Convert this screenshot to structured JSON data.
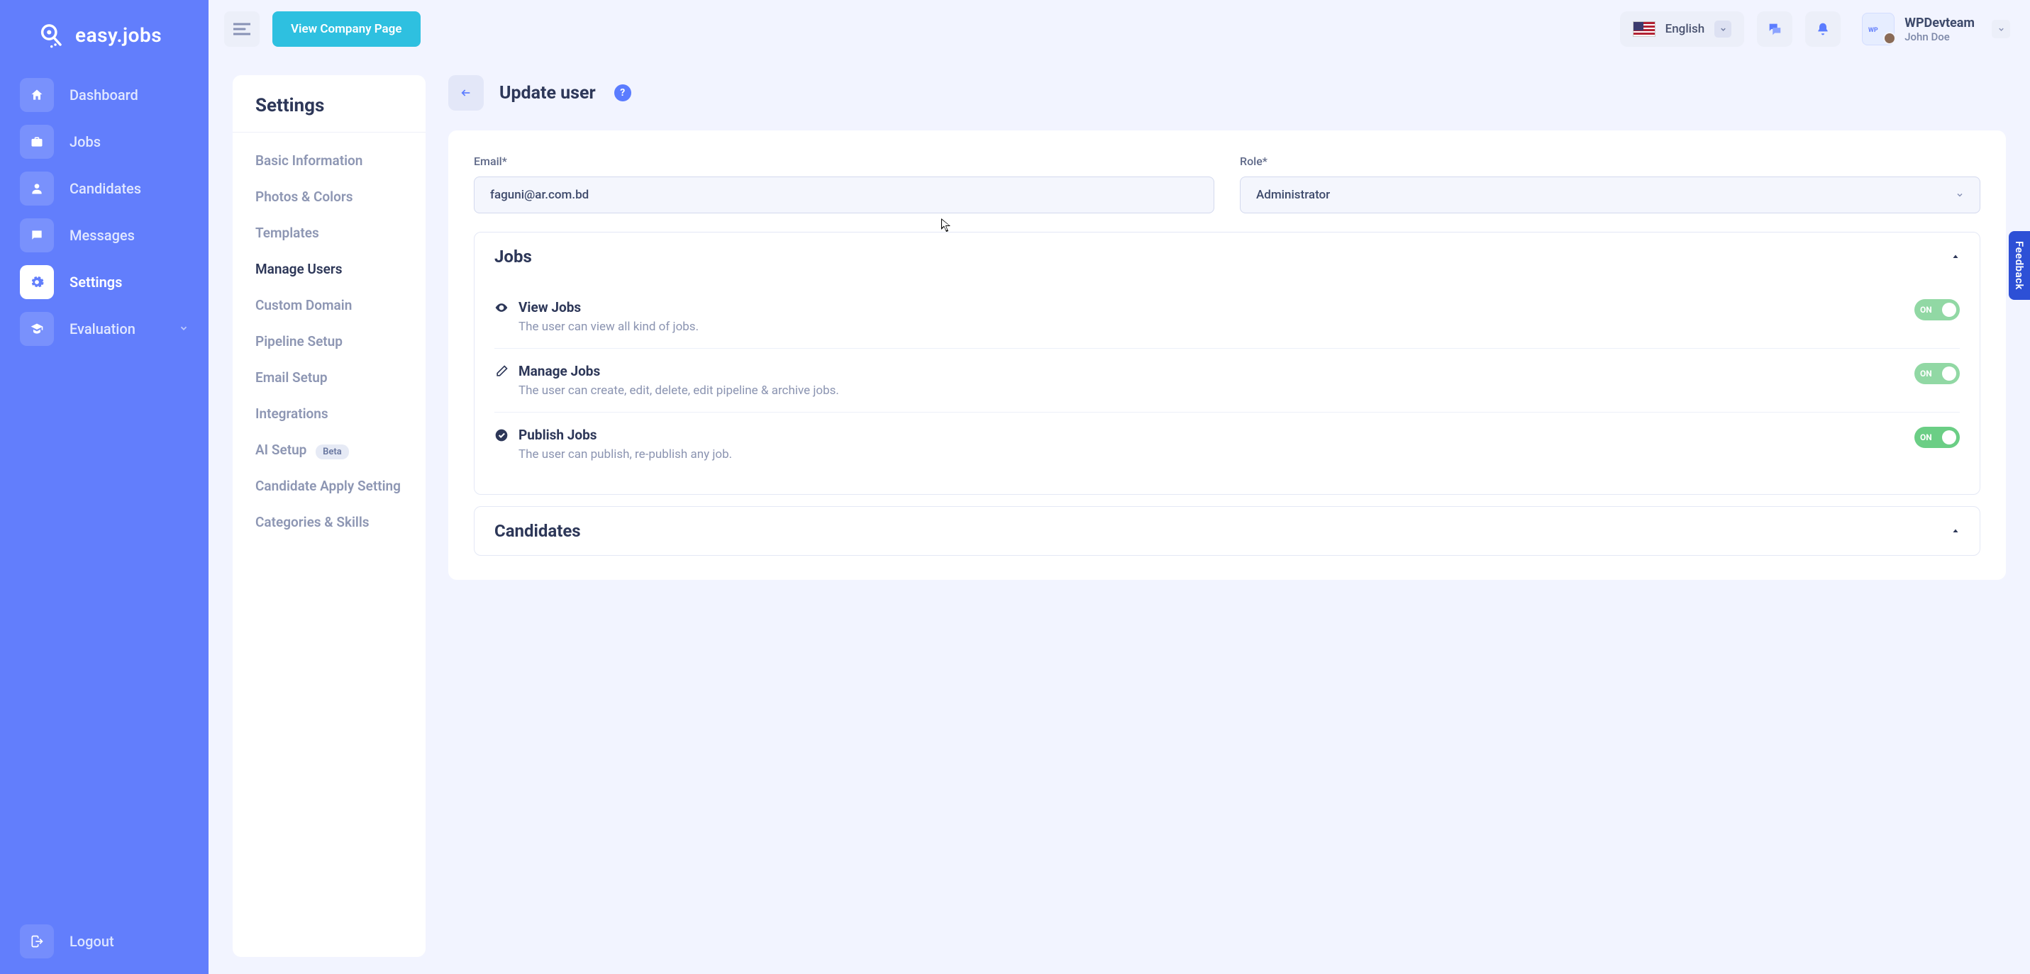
{
  "brand": {
    "name": "easy.jobs"
  },
  "nav": {
    "items": [
      {
        "label": "Dashboard"
      },
      {
        "label": "Jobs"
      },
      {
        "label": "Candidates"
      },
      {
        "label": "Messages"
      },
      {
        "label": "Settings"
      },
      {
        "label": "Evaluation",
        "has_chevron": true
      }
    ],
    "logout": "Logout"
  },
  "topbar": {
    "view_company": "View Company Page",
    "language": "English",
    "team": "WPDevteam",
    "user": "John Doe"
  },
  "settings": {
    "title": "Settings",
    "items": [
      {
        "label": "Basic Information"
      },
      {
        "label": "Photos & Colors"
      },
      {
        "label": "Templates"
      },
      {
        "label": "Manage Users",
        "active": true
      },
      {
        "label": "Custom Domain"
      },
      {
        "label": "Pipeline Setup"
      },
      {
        "label": "Email Setup"
      },
      {
        "label": "Integrations"
      },
      {
        "label": "AI Setup",
        "badge": "Beta"
      },
      {
        "label": "Candidate Apply Setting"
      },
      {
        "label": "Categories & Skills"
      }
    ]
  },
  "page": {
    "title": "Update user",
    "email_label": "Email*",
    "email_value": "faguni@ar.com.bd",
    "role_label": "Role*",
    "role_value": "Administrator"
  },
  "permissions": {
    "jobs_title": "Jobs",
    "candidates_title": "Candidates",
    "jobs": [
      {
        "title": "View Jobs",
        "desc": "The user can view all kind of jobs.",
        "toggle_label": "ON",
        "muted": true
      },
      {
        "title": "Manage Jobs",
        "desc": "The user can create, edit, delete, edit pipeline & archive jobs.",
        "toggle_label": "ON",
        "muted": true
      },
      {
        "title": "Publish Jobs",
        "desc": "The user can publish, re-publish any job.",
        "toggle_label": "ON",
        "muted": false
      }
    ]
  },
  "feedback": "Feedback"
}
